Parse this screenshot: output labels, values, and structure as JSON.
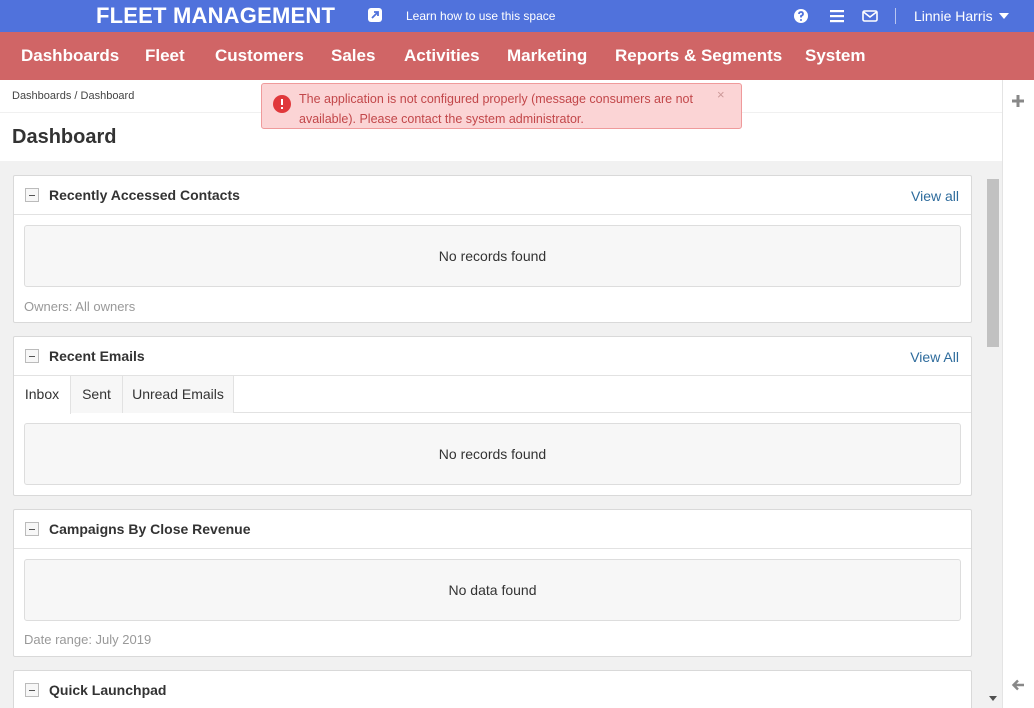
{
  "topbar": {
    "brand": "FLEET MANAGEMENT",
    "learn_link": "Learn how to use this space",
    "user_name": "Linnie Harris",
    "icons": [
      "external-link-icon",
      "help-icon",
      "menu-icon",
      "mail-icon",
      "caret-down-icon"
    ]
  },
  "nav": {
    "items": [
      "Dashboards",
      "Fleet",
      "Customers",
      "Sales",
      "Activities",
      "Marketing",
      "Reports & Segments",
      "System"
    ]
  },
  "breadcrumb": {
    "parent": "Dashboards",
    "separator": "/",
    "current": "Dashboard"
  },
  "page": {
    "title": "Dashboard"
  },
  "alert": {
    "message": "The application is not configured properly (message consumers are not available). Please contact the system administrator.",
    "close": "×"
  },
  "widgets": {
    "recent_contacts": {
      "title": "Recently Accessed Contacts",
      "view_all": "View all",
      "empty": "No records found",
      "footer": "Owners: All owners"
    },
    "recent_emails": {
      "title": "Recent Emails",
      "view_all": "View All",
      "tabs": [
        "Inbox",
        "Sent",
        "Unread Emails"
      ],
      "active_tab": "Inbox",
      "empty": "No records found"
    },
    "campaigns": {
      "title": "Campaigns By Close Revenue",
      "empty": "No data found",
      "footer": "Date range: July 2019"
    },
    "launchpad": {
      "title": "Quick Launchpad"
    }
  },
  "colors": {
    "topbar": "#5072dc",
    "nav": "#d06566",
    "link": "#2d6b9c",
    "alert_bg": "#fbd4d5",
    "alert_text": "#c2474a"
  }
}
